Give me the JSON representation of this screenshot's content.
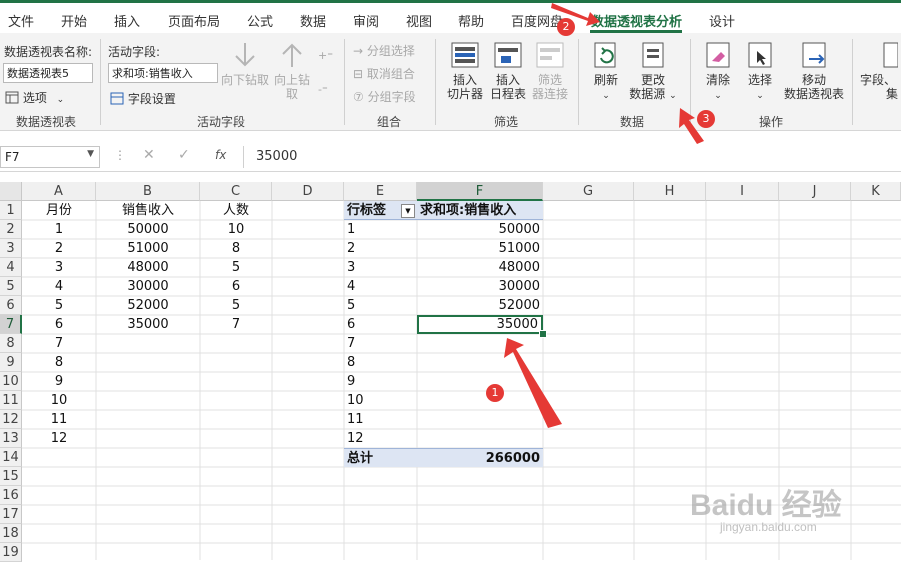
{
  "tabs": [
    "文件",
    "开始",
    "插入",
    "页面布局",
    "公式",
    "数据",
    "审阅",
    "视图",
    "帮助",
    "百度网盘",
    "数据透视表分析",
    "设计"
  ],
  "ribbon": {
    "pivot_name_label": "数据透视表名称:",
    "pivot_name_value": "数据透视表5",
    "options_label": "选项",
    "group_pivot": "数据透视表",
    "active_field_label": "活动字段:",
    "active_field_value": "求和项:销售收入",
    "field_settings": "字段设置",
    "drill_down": "向下钻取",
    "drill_up_1": "向上钻",
    "drill_up_2": "取",
    "group_active_field": "活动字段",
    "group_selection": "分组选择",
    "ungroup": "取消组合",
    "group_field": "分组字段",
    "group_group": "组合",
    "insert_slicer_1": "插入",
    "insert_slicer_2": "切片器",
    "insert_timeline_1": "插入",
    "insert_timeline_2": "日程表",
    "filter_conn_1": "筛选",
    "filter_conn_2": "器连接",
    "group_filter": "筛选",
    "refresh": "刷新",
    "change_source_1": "更改",
    "change_source_2": "数据源",
    "group_data": "数据",
    "clear": "清除",
    "select": "选择",
    "move_pivot_1": "移动",
    "move_pivot_2": "数据透视表",
    "group_actions": "操作",
    "fields_1": "字段、",
    "fields_2": "集"
  },
  "formula_bar": {
    "name_box": "F7",
    "formula": "35000"
  },
  "columns": [
    "A",
    "B",
    "C",
    "D",
    "E",
    "F",
    "G",
    "H",
    "I",
    "J",
    "K"
  ],
  "rows": [
    "1",
    "2",
    "3",
    "4",
    "5",
    "6",
    "7",
    "8",
    "9",
    "10",
    "11",
    "12",
    "13",
    "14",
    "15",
    "16",
    "17",
    "18",
    "19"
  ],
  "sheet": {
    "header_a": "月份",
    "header_b": "销售收入",
    "header_c": "人数",
    "col_a": [
      "1",
      "2",
      "3",
      "4",
      "5",
      "6",
      "7",
      "8",
      "9",
      "10",
      "11",
      "12"
    ],
    "col_b": [
      "50000",
      "51000",
      "48000",
      "30000",
      "52000",
      "35000"
    ],
    "col_c": [
      "10",
      "8",
      "5",
      "6",
      "5",
      "7"
    ]
  },
  "pivot": {
    "row_label": "行标签",
    "value_label": "求和项:销售收入",
    "labels": [
      "1",
      "2",
      "3",
      "4",
      "5",
      "6",
      "7",
      "8",
      "9",
      "10",
      "11",
      "12"
    ],
    "values": [
      "50000",
      "51000",
      "48000",
      "30000",
      "52000",
      "35000"
    ],
    "total_label": "总计",
    "total_value": "266000"
  },
  "badges": [
    "1",
    "2",
    "3"
  ],
  "watermark": "Baidu 经验",
  "watermark_url": "jingyan.baidu.com",
  "colors": {
    "accent": "#217346",
    "pivot_header": "#dde5f3",
    "annotation": "#e53935"
  }
}
